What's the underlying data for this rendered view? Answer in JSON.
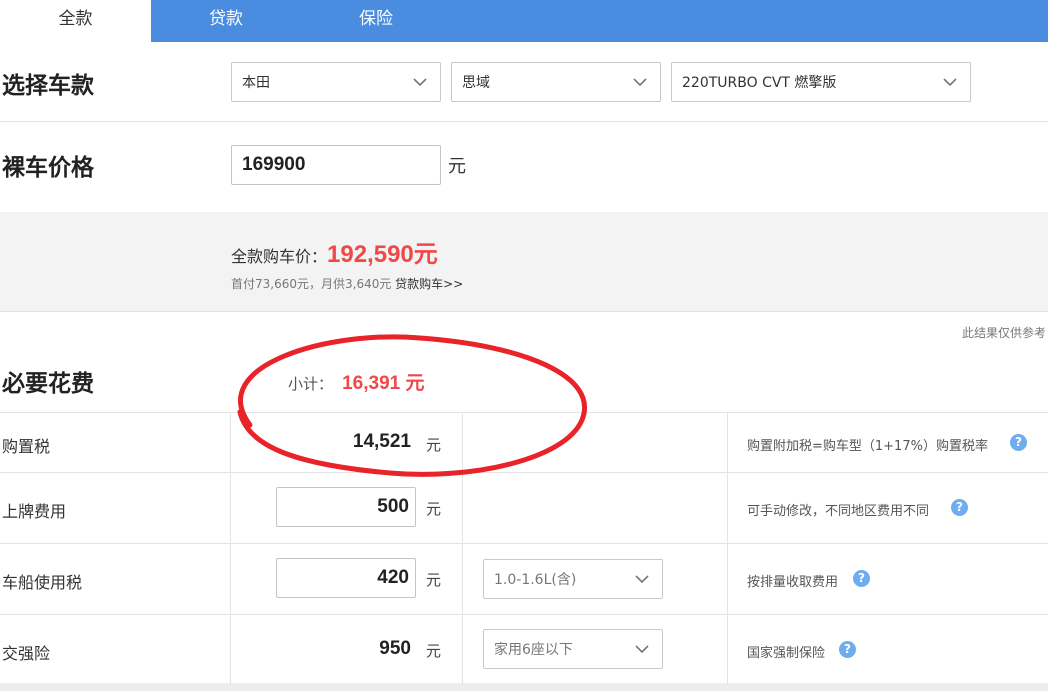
{
  "tabs": [
    {
      "label": "全款"
    },
    {
      "label": "贷款"
    },
    {
      "label": "保险"
    }
  ],
  "select_car": {
    "title": "选择车款",
    "brand": "本田",
    "series": "思域",
    "model": "220TURBO CVT 燃擎版"
  },
  "bare_price": {
    "title": "裸车价格",
    "value": "169900",
    "unit": "元"
  },
  "summary": {
    "label": "全款购车价：",
    "total": "192,590元",
    "sub_text": "首付73,660元，月供3,640元",
    "loan_link": "贷款购车>>"
  },
  "required": {
    "disclaimer": "此结果仅供参考",
    "title": "必要花费",
    "subtotal_label": "小计：",
    "subtotal_value": "16,391 元",
    "rows": [
      {
        "label": "购置税",
        "value": "14,521",
        "unit": "元",
        "note": "购置附加税=购车型（1+17%）购置税率"
      },
      {
        "label": "上牌费用",
        "value": "500",
        "unit": "元",
        "note": "可手动修改，不同地区费用不同"
      },
      {
        "label": "车船使用税",
        "value": "420",
        "unit": "元",
        "option": "1.0-1.6L(含)",
        "note": "按排量收取费用"
      },
      {
        "label": "交强险",
        "value": "950",
        "unit": "元",
        "option": "家用6座以下",
        "note": "国家强制保险"
      }
    ]
  },
  "colors": {
    "tab_bar": "#4a8ce0",
    "highlight_red": "#f04848",
    "annotation_circle": "#e8232a",
    "help_icon": "#6eaef0"
  }
}
